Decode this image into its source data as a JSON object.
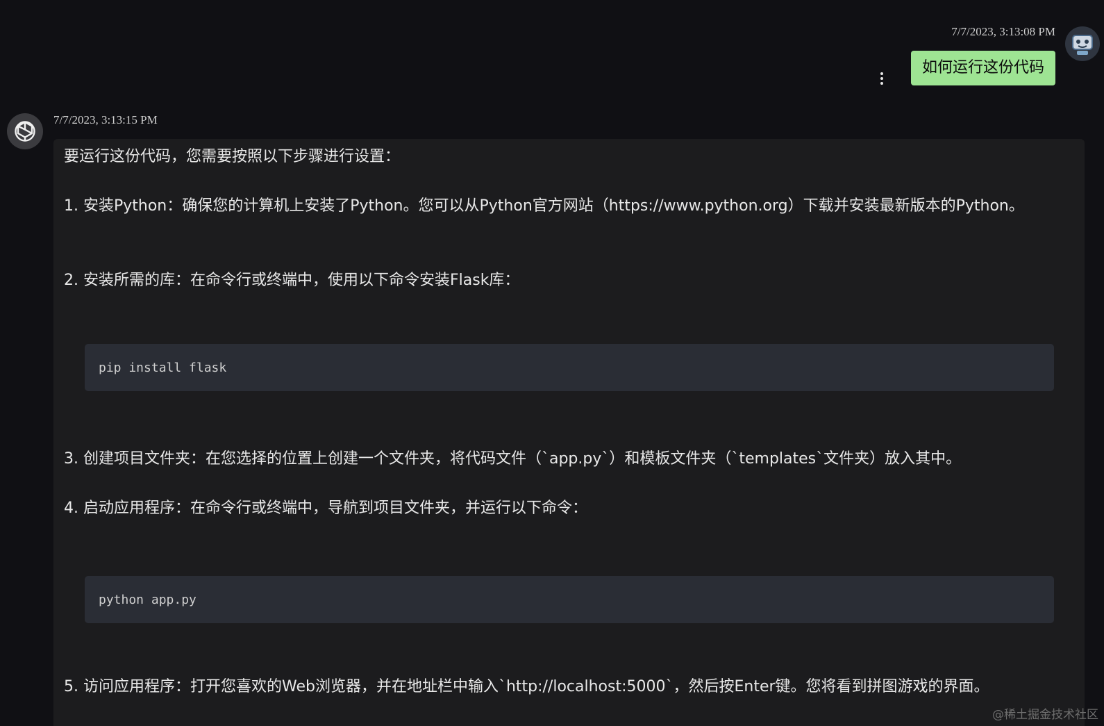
{
  "user_message": {
    "timestamp": "7/7/2023, 3:13:08 PM",
    "text": "如何运行这份代码",
    "avatar_icon": "robot-avatar-icon",
    "bubble_color": "#9ee493"
  },
  "assistant_message": {
    "timestamp": "7/7/2023, 3:13:15 PM",
    "avatar_icon": "openai-logo-icon",
    "intro": "要运行这份代码，您需要按照以下步骤进行设置：",
    "step1": "1. 安装Python：确保您的计算机上安装了Python。您可以从Python官方网站（https://www.python.org）下载并安装最新版本的Python。",
    "step2": "2. 安装所需的库：在命令行或终端中，使用以下命令安装Flask库：",
    "code1": "pip install flask",
    "step3": "3. 创建项目文件夹：在您选择的位置上创建一个文件夹，将代码文件（`app.py`）和模板文件夹（`templates`文件夹）放入其中。",
    "step4": "4. 启动应用程序：在命令行或终端中，导航到项目文件夹，并运行以下命令：",
    "code2": "python app.py",
    "step5": "5. 访问应用程序：打开您喜欢的Web浏览器，并在地址栏中输入`http://localhost:5000`，然后按Enter键。您将看到拼图游戏的界面。"
  },
  "watermark": "@稀土掘金技术社区"
}
